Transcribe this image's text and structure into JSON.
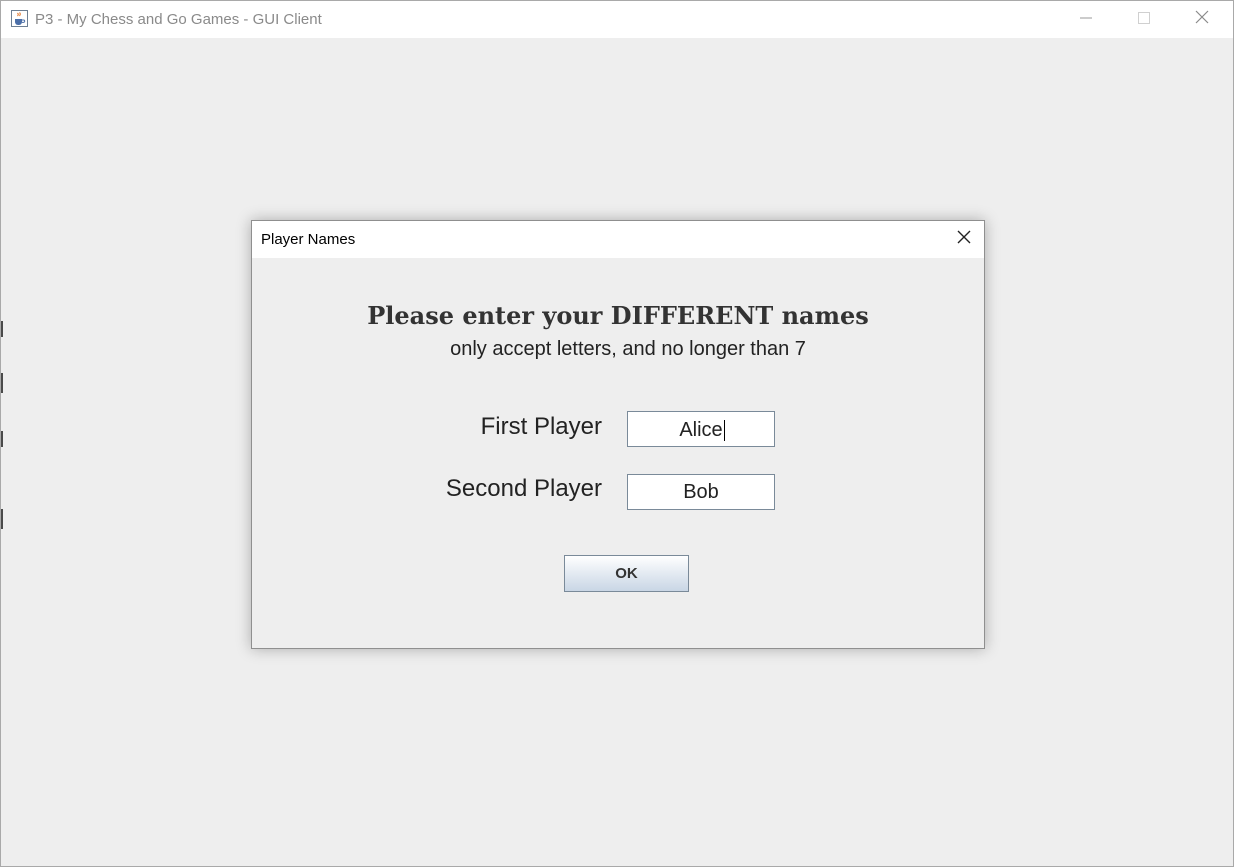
{
  "window": {
    "title": "P3 - My Chess and Go Games - GUI Client",
    "icon": "java-coffee-icon",
    "controls": [
      "minimize-icon",
      "maximize-icon",
      "close-icon"
    ]
  },
  "dialog": {
    "title": "Player Names",
    "close_icon": "close-icon",
    "heading": "Please enter your DIFFERENT names",
    "subheading": "only accept letters, and no longer than 7",
    "first_player": {
      "label": "First Player",
      "value": "Alice"
    },
    "second_player": {
      "label": "Second Player",
      "value": "Bob"
    },
    "ok_label": "OK"
  },
  "colors": {
    "background": "#eeeeee",
    "titlebar": "#ffffff",
    "field_border": "#7a8a99",
    "text": "#222222"
  }
}
